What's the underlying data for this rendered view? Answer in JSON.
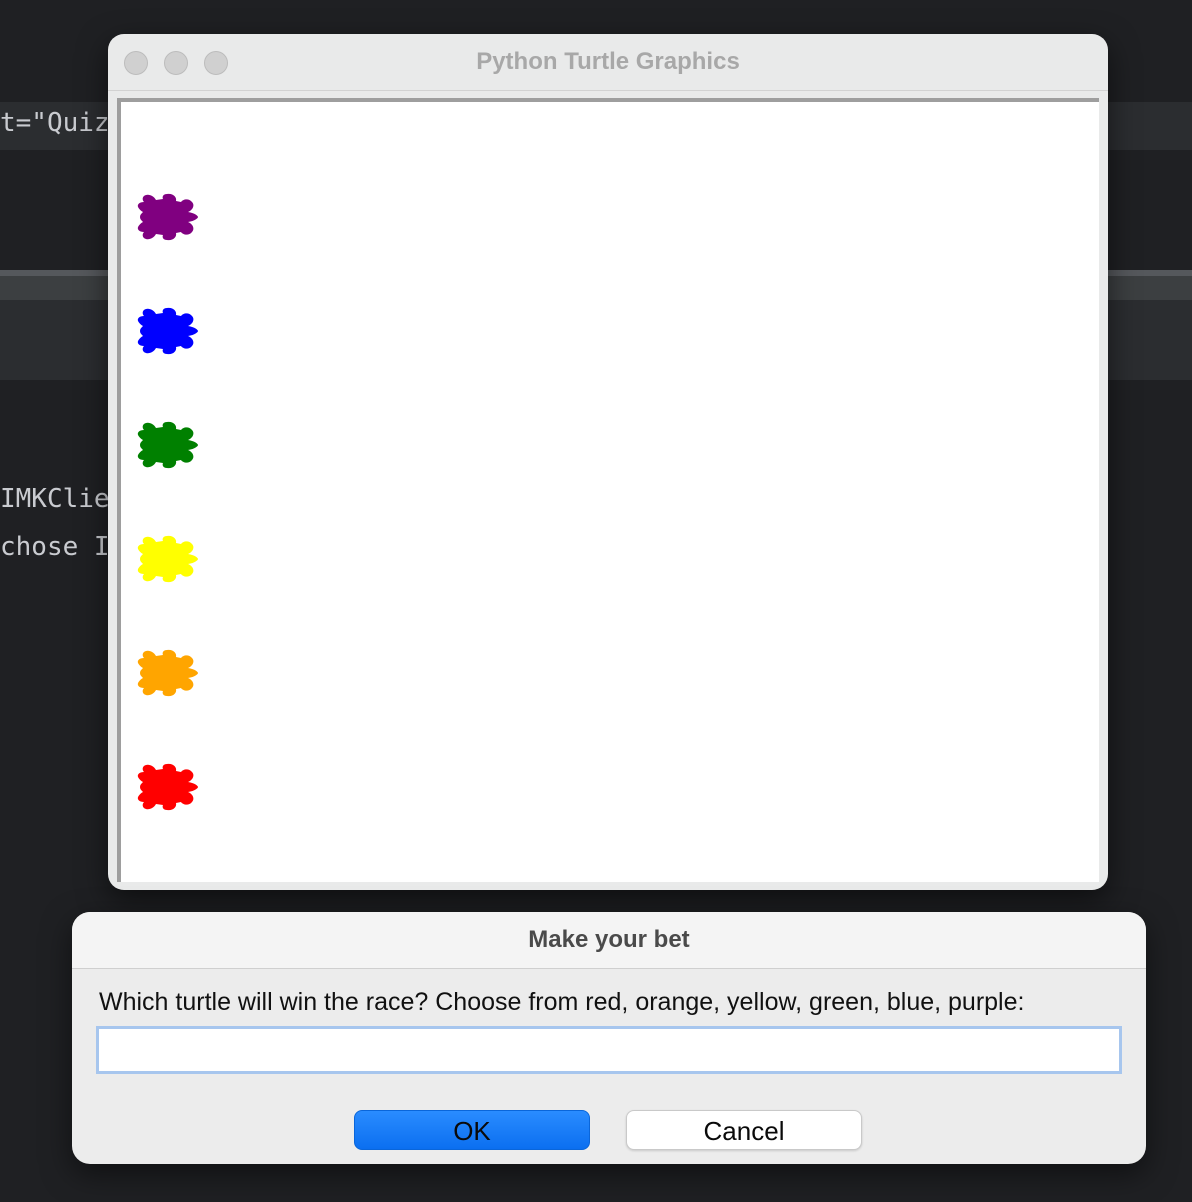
{
  "background_ide": {
    "fragments": [
      "t=\"Quiz",
      "IMKClie",
      "chose I"
    ]
  },
  "turtle_window": {
    "title": "Python Turtle Graphics",
    "turtles": [
      {
        "name": "purple",
        "color": "#800080"
      },
      {
        "name": "blue",
        "color": "#0000ff"
      },
      {
        "name": "green",
        "color": "#008000"
      },
      {
        "name": "yellow",
        "color": "#ffff00"
      },
      {
        "name": "orange",
        "color": "#ffa500"
      },
      {
        "name": "red",
        "color": "#ff0000"
      }
    ]
  },
  "dialog": {
    "title": "Make your bet",
    "prompt": "Which turtle will win the race? Choose from red, orange, yellow, green, blue, purple:",
    "input": {
      "value": "",
      "placeholder": ""
    },
    "ok_label": "OK",
    "cancel_label": "Cancel"
  },
  "colors": {
    "accent": "#0b6ff0",
    "focus_ring": "#a7c6ee"
  }
}
